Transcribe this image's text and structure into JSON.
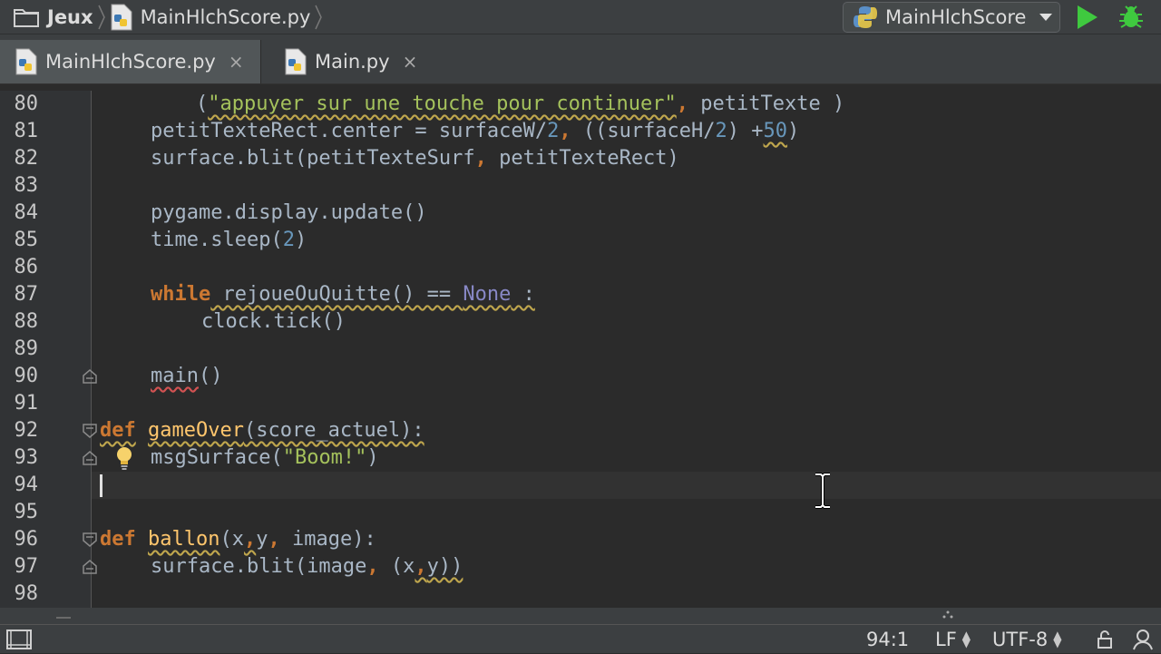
{
  "navbar": {
    "project": "Jeux",
    "file": "MainHlchScore.py",
    "run_config": "MainHlchScore"
  },
  "tabs": [
    {
      "label": "MainHlchScore.py",
      "close": "×"
    },
    {
      "label": "Main.py",
      "close": "×"
    }
  ],
  "editor": {
    "line_numbers": [
      "80",
      "81",
      "82",
      "83",
      "84",
      "85",
      "86",
      "87",
      "88",
      "89",
      "90",
      "91",
      "92",
      "93",
      "94",
      "95",
      "96",
      "97",
      "98"
    ],
    "code": {
      "l80": {
        "indent": "    ",
        "open": "(",
        "str": "\"appuyer sur une touche pour continuer\"",
        "comma": ",",
        "rest": " petitTexte ",
        "close": ")"
      },
      "l81": {
        "a": "petitTexteRect.center = surfaceW/",
        "n1": "2",
        "comma": ",",
        "b": " ((surfaceH/",
        "n2": "2",
        "c": ") +",
        "n3": "50",
        "d": ")"
      },
      "l82": {
        "a": "surface.blit(petitTexteSurf",
        "comma": ",",
        "b": " petitTexteRect)"
      },
      "l84": {
        "a": "pygame.display.update()"
      },
      "l85": {
        "a": "time.sleep(",
        "n": "2",
        "b": ")"
      },
      "l87": {
        "kw": "while",
        "a": " rejoueOuQuitte() == ",
        "const": "None",
        "b": " :"
      },
      "l88": {
        "a": "clock.tick()"
      },
      "l90": {
        "a": "main",
        "b": "()"
      },
      "l92": {
        "kw": "def",
        "name": "gameOver",
        "a": "(score_actuel):"
      },
      "l93": {
        "a": "msgSurface(",
        "str": "\"Boom!\"",
        "b": ")"
      },
      "l96": {
        "kw": "def",
        "name": "ballon",
        "a": "(x",
        "c1": ",",
        "b": "y",
        "c2": ",",
        "c": " image):"
      },
      "l97": {
        "a": "surface.blit(image",
        "c1": ",",
        "b": " (x",
        "c2": ",",
        "c": "y))"
      }
    }
  },
  "status": {
    "position": "94:1",
    "line_separator": "LF",
    "encoding": "UTF-8"
  },
  "colors": {
    "keyword": "#cc7832",
    "string": "#a5c25c",
    "number": "#6897bb",
    "constant": "#8888c6",
    "code": "#a9b7c6",
    "background": "#2b2b2b"
  },
  "icons": [
    "folder-icon",
    "python-file-icon",
    "python-icon",
    "run-icon",
    "debug-icon",
    "fold-icon",
    "lightbulb-icon",
    "text-cursor-icon",
    "tool-window-icon",
    "lock-icon"
  ]
}
